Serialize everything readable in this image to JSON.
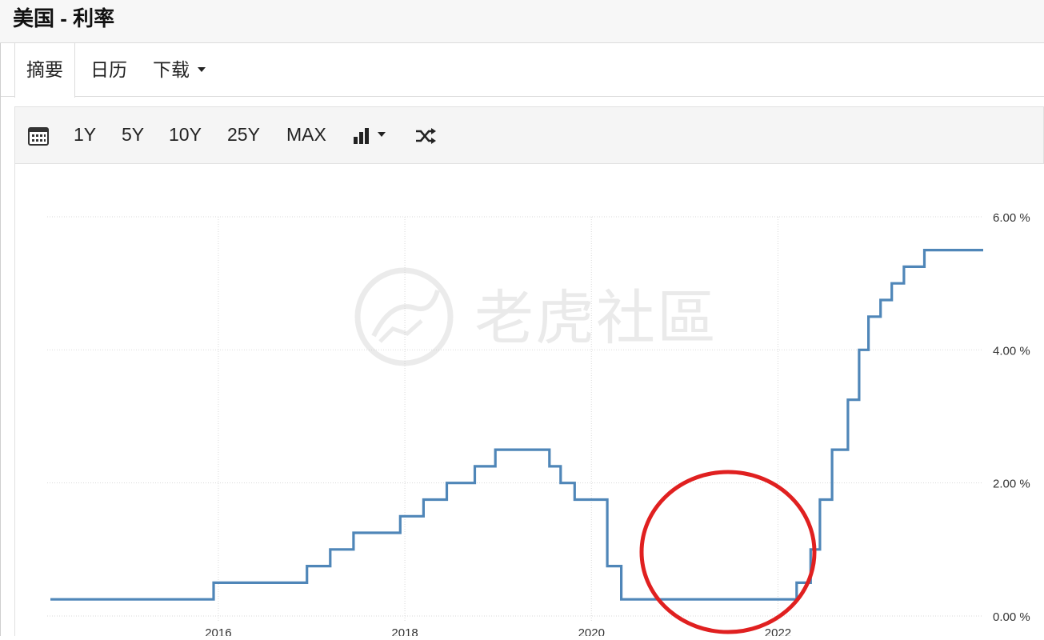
{
  "header": {
    "title": "美国 - 利率"
  },
  "tabs": [
    {
      "label": "摘要",
      "active": true
    },
    {
      "label": "日历",
      "active": false
    },
    {
      "label": "下载",
      "active": false,
      "has_dropdown": true
    }
  ],
  "toolbar": {
    "calendar_icon": "calendar-icon",
    "ranges": [
      "1Y",
      "5Y",
      "10Y",
      "25Y",
      "MAX"
    ],
    "chart_type_icon": "bar-chart-icon",
    "shuffle_icon": "shuffle-icon"
  },
  "watermark": {
    "text": "老虎社區"
  },
  "colors": {
    "series": "#4f86b8",
    "annotation": "#e02020",
    "grid": "#d9d9d9"
  },
  "chart_data": {
    "type": "line",
    "step": true,
    "x_ticks": [
      "2016",
      "2018",
      "2020",
      "2022"
    ],
    "y_ticks": [
      "0.00 %",
      "2.00 %",
      "4.00 %",
      "6.00 %"
    ],
    "ylim": [
      0,
      6
    ],
    "xlim": [
      2014.2,
      2024.2
    ],
    "grid": true,
    "y_axis_position": "right",
    "annotation": "red circle around 2020.5–2022.2 near 0%",
    "series": [
      {
        "points": [
          [
            2014.2,
            0.25
          ],
          [
            2015.95,
            0.5
          ],
          [
            2016.95,
            0.75
          ],
          [
            2017.2,
            1.0
          ],
          [
            2017.45,
            1.25
          ],
          [
            2017.95,
            1.5
          ],
          [
            2018.2,
            1.75
          ],
          [
            2018.45,
            2.0
          ],
          [
            2018.75,
            2.25
          ],
          [
            2018.97,
            2.5
          ],
          [
            2019.55,
            2.25
          ],
          [
            2019.67,
            2.0
          ],
          [
            2019.82,
            1.75
          ],
          [
            2020.17,
            0.75
          ],
          [
            2020.32,
            0.25
          ],
          [
            2022.2,
            0.5
          ],
          [
            2022.35,
            1.0
          ],
          [
            2022.45,
            1.75
          ],
          [
            2022.58,
            2.5
          ],
          [
            2022.75,
            3.25
          ],
          [
            2022.87,
            4.0
          ],
          [
            2022.97,
            4.5
          ],
          [
            2023.1,
            4.75
          ],
          [
            2023.22,
            5.0
          ],
          [
            2023.35,
            5.25
          ],
          [
            2023.57,
            5.5
          ],
          [
            2024.2,
            5.5
          ]
        ]
      }
    ]
  }
}
